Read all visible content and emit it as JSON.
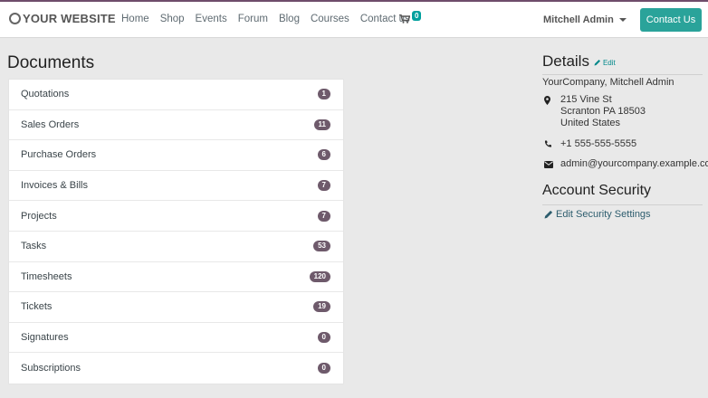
{
  "header": {
    "logo_text": "YOUR WEBSITE",
    "nav": [
      "Home",
      "Shop",
      "Events",
      "Forum",
      "Blog",
      "Courses",
      "Contact us"
    ],
    "cart_count": "0",
    "user_name": "Mitchell Admin",
    "contact_button": "Contact Us"
  },
  "documents": {
    "title": "Documents",
    "items": [
      {
        "label": "Quotations",
        "count": "1"
      },
      {
        "label": "Sales Orders",
        "count": "11"
      },
      {
        "label": "Purchase Orders",
        "count": "6"
      },
      {
        "label": "Invoices & Bills",
        "count": "7"
      },
      {
        "label": "Projects",
        "count": "7"
      },
      {
        "label": "Tasks",
        "count": "53"
      },
      {
        "label": "Timesheets",
        "count": "120"
      },
      {
        "label": "Tickets",
        "count": "19"
      },
      {
        "label": "Signatures",
        "count": "0"
      },
      {
        "label": "Subscriptions",
        "count": "0"
      }
    ]
  },
  "details": {
    "title": "Details",
    "edit_label": "Edit",
    "company": "YourCompany, Mitchell Admin",
    "address_line1": "215 Vine St",
    "address_line2": "Scranton PA 18503",
    "address_line3": "United States",
    "phone": "+1 555-555-5555",
    "email": "admin@yourcompany.example.com"
  },
  "security": {
    "title": "Account Security",
    "edit_link": "Edit Security Settings"
  },
  "colors": {
    "brand_top": "#6f4d6b",
    "accent": "#2aa39a",
    "badge": "#6e5a6b"
  }
}
